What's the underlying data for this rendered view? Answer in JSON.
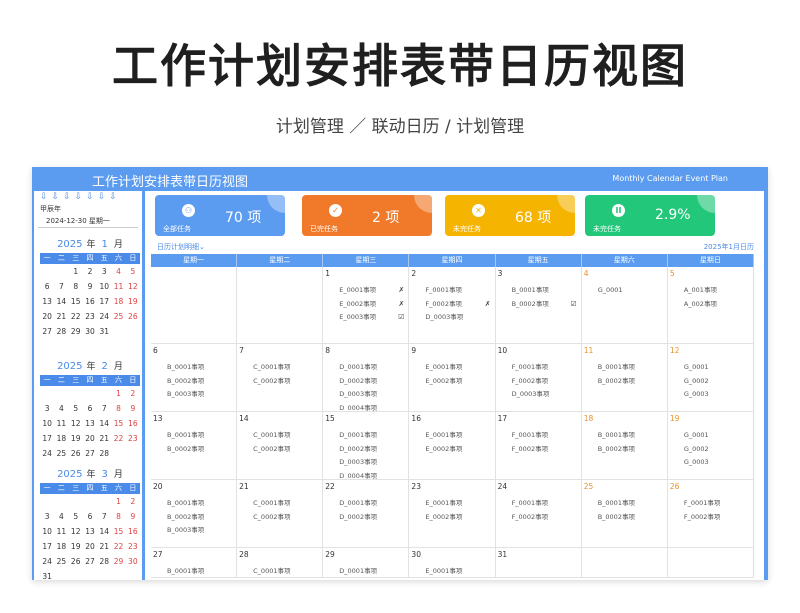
{
  "hero": {
    "title": "工作计划安排表带日历视图",
    "subtitle": "计划管理 ／ 联动日历 / 计划管理"
  },
  "app": {
    "title": "工作计划安排表带日历视图",
    "subtitle": "Monthly Calendar Event Plan"
  },
  "sidebar": {
    "arrows": "⇩⇩⇩⇩⇩⇩⇩",
    "label": "甲辰年",
    "date": "2024-12-30  星期一",
    "weekdays": [
      "一",
      "二",
      "三",
      "四",
      "五",
      "六",
      "日"
    ],
    "months": [
      {
        "year": "2025",
        "year_suffix": "年",
        "month": "1",
        "month_suffix": "月",
        "rows": [
          [
            "",
            "",
            "1",
            "2",
            "3",
            "4",
            "5"
          ],
          [
            "6",
            "7",
            "8",
            "9",
            "10",
            "11",
            "12"
          ],
          [
            "13",
            "14",
            "15",
            "16",
            "17",
            "18",
            "19"
          ],
          [
            "20",
            "21",
            "22",
            "23",
            "24",
            "25",
            "26"
          ],
          [
            "27",
            "28",
            "29",
            "30",
            "31",
            "",
            ""
          ]
        ]
      },
      {
        "year": "2025",
        "year_suffix": "年",
        "month": "2",
        "month_suffix": "月",
        "rows": [
          [
            "",
            "",
            "",
            "",
            "",
            "1",
            "2"
          ],
          [
            "3",
            "4",
            "5",
            "6",
            "7",
            "8",
            "9"
          ],
          [
            "10",
            "11",
            "12",
            "13",
            "14",
            "15",
            "16"
          ],
          [
            "17",
            "18",
            "19",
            "20",
            "21",
            "22",
            "23"
          ],
          [
            "24",
            "25",
            "26",
            "27",
            "28",
            "",
            ""
          ]
        ]
      },
      {
        "year": "2025",
        "year_suffix": "年",
        "month": "3",
        "month_suffix": "月",
        "rows": [
          [
            "",
            "",
            "",
            "",
            "",
            "1",
            "2"
          ],
          [
            "3",
            "4",
            "5",
            "6",
            "7",
            "8",
            "9"
          ],
          [
            "10",
            "11",
            "12",
            "13",
            "14",
            "15",
            "16"
          ],
          [
            "17",
            "18",
            "19",
            "20",
            "21",
            "22",
            "23"
          ],
          [
            "24",
            "25",
            "26",
            "27",
            "28",
            "29",
            "30"
          ],
          [
            "31",
            "",
            "",
            "",
            "",
            "",
            ""
          ]
        ]
      }
    ]
  },
  "cards": [
    {
      "value": "70 项",
      "label": "全部任务",
      "color": "#5b9cf0",
      "icon": "group-icon",
      "glyph": "⚇"
    },
    {
      "value": "2 项",
      "label": "已完任务",
      "color": "#f07a2a",
      "icon": "check-icon",
      "glyph": "✓"
    },
    {
      "value": "68 项",
      "label": "未完任务",
      "color": "#f5b400",
      "icon": "cross-icon",
      "glyph": "✕"
    },
    {
      "value": "2.9%",
      "label": "未完任务",
      "color": "#22c77a",
      "icon": "percent-icon",
      "glyph": "II"
    }
  ],
  "legend_left": "日历计划明细⌄",
  "legend_right": "2025年1月日历",
  "weekday_headers": [
    "星期一",
    "星期二",
    "星期三",
    "星期四",
    "星期五",
    "星期六",
    "星期日"
  ],
  "weeks": [
    [
      {
        "day": "",
        "items": []
      },
      {
        "day": "",
        "items": []
      },
      {
        "day": "1",
        "items": [
          {
            "t": "E_0001事项",
            "m": "✗"
          },
          {
            "t": "E_0002事项",
            "m": "✗"
          },
          {
            "t": "E_0003事项",
            "m": "☑"
          }
        ]
      },
      {
        "day": "2",
        "items": [
          {
            "t": "F_0001事项",
            "m": ""
          },
          {
            "t": "F_0002事项",
            "m": "✗"
          },
          {
            "t": "D_0003事项",
            "m": ""
          }
        ]
      },
      {
        "day": "3",
        "items": [
          {
            "t": "B_0001事项",
            "m": ""
          },
          {
            "t": "B_0002事项",
            "m": "☑"
          }
        ]
      },
      {
        "day": "4",
        "items": [
          {
            "t": "G_0001",
            "m": ""
          }
        ]
      },
      {
        "day": "5",
        "items": [
          {
            "t": "A_001事项",
            "m": ""
          },
          {
            "t": "A_002事项",
            "m": ""
          }
        ]
      }
    ],
    [
      {
        "day": "6",
        "items": [
          {
            "t": "B_0001事项",
            "m": ""
          },
          {
            "t": "B_0002事项",
            "m": ""
          },
          {
            "t": "B_0003事项",
            "m": ""
          }
        ]
      },
      {
        "day": "7",
        "items": [
          {
            "t": "C_0001事项",
            "m": ""
          },
          {
            "t": "C_0002事项",
            "m": ""
          }
        ]
      },
      {
        "day": "8",
        "items": [
          {
            "t": "D_0001事项",
            "m": ""
          },
          {
            "t": "D_0002事项",
            "m": ""
          },
          {
            "t": "D_0003事项",
            "m": ""
          },
          {
            "t": "D_0004事项",
            "m": ""
          }
        ]
      },
      {
        "day": "9",
        "items": [
          {
            "t": "E_0001事项",
            "m": ""
          },
          {
            "t": "E_0002事项",
            "m": ""
          }
        ]
      },
      {
        "day": "10",
        "items": [
          {
            "t": "F_0001事项",
            "m": ""
          },
          {
            "t": "F_0002事项",
            "m": ""
          },
          {
            "t": "D_0003事项",
            "m": ""
          }
        ]
      },
      {
        "day": "11",
        "items": [
          {
            "t": "B_0001事项",
            "m": ""
          },
          {
            "t": "B_0002事项",
            "m": ""
          }
        ]
      },
      {
        "day": "12",
        "items": [
          {
            "t": "G_0001",
            "m": ""
          },
          {
            "t": "G_0002",
            "m": ""
          },
          {
            "t": "G_0003",
            "m": ""
          }
        ]
      }
    ],
    [
      {
        "day": "13",
        "items": [
          {
            "t": "B_0001事项",
            "m": ""
          },
          {
            "t": "B_0002事项",
            "m": ""
          }
        ]
      },
      {
        "day": "14",
        "items": [
          {
            "t": "C_0001事项",
            "m": ""
          },
          {
            "t": "C_0002事项",
            "m": ""
          }
        ]
      },
      {
        "day": "15",
        "items": [
          {
            "t": "D_0001事项",
            "m": ""
          },
          {
            "t": "D_0002事项",
            "m": ""
          },
          {
            "t": "D_0003事项",
            "m": ""
          },
          {
            "t": "D_0004事项",
            "m": ""
          }
        ]
      },
      {
        "day": "16",
        "items": [
          {
            "t": "E_0001事项",
            "m": ""
          },
          {
            "t": "E_0002事项",
            "m": ""
          }
        ]
      },
      {
        "day": "17",
        "items": [
          {
            "t": "F_0001事项",
            "m": ""
          },
          {
            "t": "F_0002事项",
            "m": ""
          }
        ]
      },
      {
        "day": "18",
        "items": [
          {
            "t": "B_0001事项",
            "m": ""
          },
          {
            "t": "B_0002事项",
            "m": ""
          }
        ]
      },
      {
        "day": "19",
        "items": [
          {
            "t": "G_0001",
            "m": ""
          },
          {
            "t": "G_0002",
            "m": ""
          },
          {
            "t": "G_0003",
            "m": ""
          }
        ]
      }
    ],
    [
      {
        "day": "20",
        "items": [
          {
            "t": "B_0001事项",
            "m": ""
          },
          {
            "t": "B_0002事项",
            "m": ""
          },
          {
            "t": "B_0003事项",
            "m": ""
          }
        ]
      },
      {
        "day": "21",
        "items": [
          {
            "t": "C_0001事项",
            "m": ""
          },
          {
            "t": "C_0002事项",
            "m": ""
          }
        ]
      },
      {
        "day": "22",
        "items": [
          {
            "t": "D_0001事项",
            "m": ""
          },
          {
            "t": "D_0002事项",
            "m": ""
          }
        ]
      },
      {
        "day": "23",
        "items": [
          {
            "t": "E_0001事项",
            "m": ""
          },
          {
            "t": "E_0002事项",
            "m": ""
          }
        ]
      },
      {
        "day": "24",
        "items": [
          {
            "t": "F_0001事项",
            "m": ""
          },
          {
            "t": "F_0002事项",
            "m": ""
          }
        ]
      },
      {
        "day": "25",
        "items": [
          {
            "t": "B_0001事项",
            "m": ""
          },
          {
            "t": "B_0002事项",
            "m": ""
          }
        ]
      },
      {
        "day": "26",
        "items": [
          {
            "t": "F_0001事项",
            "m": ""
          },
          {
            "t": "F_0002事项",
            "m": ""
          }
        ]
      }
    ],
    [
      {
        "day": "27",
        "items": [
          {
            "t": "B_0001事项",
            "m": ""
          }
        ]
      },
      {
        "day": "28",
        "items": [
          {
            "t": "C_0001事项",
            "m": ""
          }
        ]
      },
      {
        "day": "29",
        "items": [
          {
            "t": "D_0001事项",
            "m": ""
          }
        ]
      },
      {
        "day": "30",
        "items": [
          {
            "t": "E_0001事项",
            "m": ""
          }
        ]
      },
      {
        "day": "31",
        "items": []
      },
      {
        "day": "",
        "items": []
      },
      {
        "day": "",
        "items": []
      }
    ]
  ]
}
